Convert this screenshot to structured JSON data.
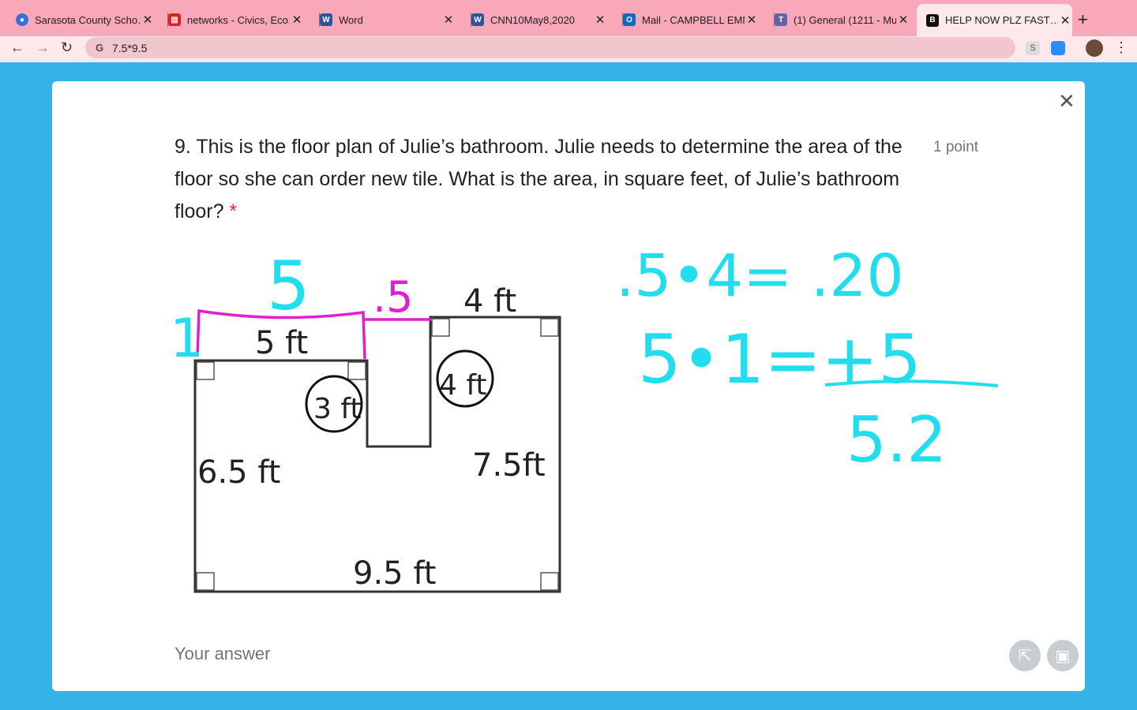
{
  "tabs": [
    {
      "title": "Sarasota County Scho…",
      "favicon_color": "#3a6fd8"
    },
    {
      "title": "networks - Civics, Eco…",
      "favicon_color": "#d22"
    },
    {
      "title": "Word",
      "favicon_color": "#2b579a"
    },
    {
      "title": "CNN10May8,2020",
      "favicon_color": "#2b579a"
    },
    {
      "title": "Mail - CAMPBELL EMM…",
      "favicon_color": "#0f6cbd"
    },
    {
      "title": "(1) General (1211 - Mu…",
      "favicon_color": "#6264a7"
    },
    {
      "title": "HELP NOW PLZ FAST…",
      "favicon_color": "#111"
    }
  ],
  "address_bar": {
    "url": "7.5*9.5"
  },
  "question": {
    "text": "9. This is the floor plan of Julie’s bathroom. Julie needs to determine the area of the floor so she can order new tile. What is the area, in square feet, of Julie’s bathroom floor?",
    "required_mark": "*",
    "points": "1 point"
  },
  "figure": {
    "labels": {
      "top_left": "5 ft",
      "top_right": "4 ft",
      "inner_left": "3 ft",
      "inner_right": "4 ft",
      "left": "6.5 ft",
      "right": "7.5ft",
      "bottom": "9.5 ft"
    }
  },
  "annotations": {
    "five": "5",
    "half": ".5",
    "one": "1",
    "line1": ".5•4= .20",
    "line2": "5•1=+5",
    "result": "5.2"
  },
  "answer": {
    "placeholder": "Your answer"
  },
  "colors": {
    "accent_pink": "#e01fd0",
    "handwriting_cyan": "#22ddee",
    "background": "#35b3e8"
  }
}
